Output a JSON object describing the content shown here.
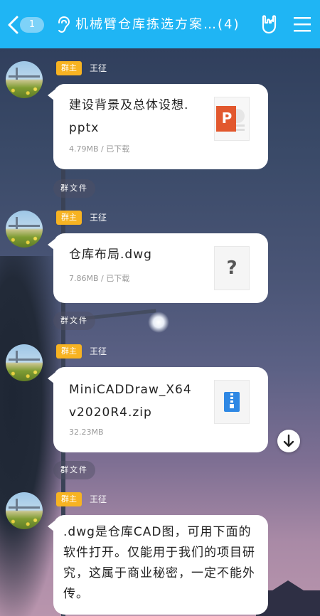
{
  "header": {
    "unread_count": "1",
    "title": "机械臂仓库拣选方案…(4)"
  },
  "messages": [
    {
      "role_tag": "群主",
      "sender": "王征",
      "file_name": "建设背景及总体设想.pptx",
      "file_meta": "4.79MB / 已下载",
      "file_type": "pptx",
      "file_icon_letter": "P",
      "label": "群文件"
    },
    {
      "role_tag": "群主",
      "sender": "王征",
      "file_name": "仓库布局.dwg",
      "file_meta": "7.86MB / 已下载",
      "file_type": "unknown",
      "file_icon_letter": "?",
      "label": "群文件"
    },
    {
      "role_tag": "群主",
      "sender": "王征",
      "file_name": "MiniCADDraw_X64v2020R4.zip",
      "file_meta": "32.23MB",
      "file_type": "zip",
      "label": "群文件"
    },
    {
      "role_tag": "群主",
      "sender": "王征",
      "text": ".dwg是仓库CAD图，可用下面的软件打开。仅能用于我们的项目研究，这属于商业秘密，一定不能外传。"
    }
  ],
  "colors": {
    "header_bg": "#1fb5f4",
    "role_tag_bg": "#f7b322",
    "ppt_orange": "#e2582e",
    "zip_blue": "#2f88e4"
  },
  "icons": {
    "back": "chevron-left-icon",
    "ear": "ear-icon",
    "hand": "rock-hand-icon",
    "menu": "hamburger-menu-icon",
    "scroll": "arrow-down-icon"
  }
}
